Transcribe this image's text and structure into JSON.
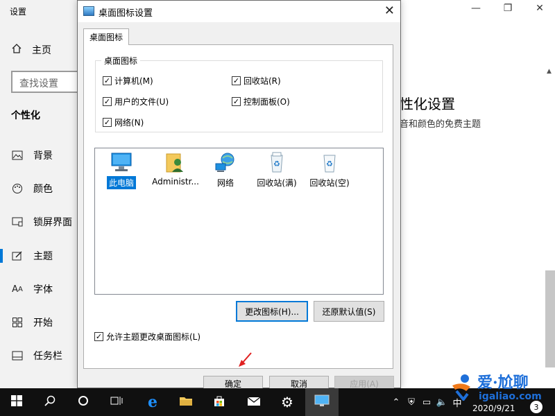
{
  "settings": {
    "window_title": "设置",
    "home_label": "主页",
    "search_placeholder": "查找设置",
    "section_title": "个性化",
    "nav_items": [
      {
        "label": "背景",
        "icon": "picture-icon"
      },
      {
        "label": "颜色",
        "icon": "palette-icon"
      },
      {
        "label": "锁屏界面",
        "icon": "lockscreen-icon"
      },
      {
        "label": "主题",
        "icon": "theme-icon"
      },
      {
        "label": "字体",
        "icon": "font-icon"
      },
      {
        "label": "开始",
        "icon": "start-icon"
      },
      {
        "label": "任务栏",
        "icon": "taskbar-icon"
      }
    ],
    "active_item": "主题",
    "right_heading": "性化设置",
    "right_subtext": "音和颜色的免费主题"
  },
  "dialog": {
    "title": "桌面图标设置",
    "tab_label": "桌面图标",
    "group_label": "桌面图标",
    "checkboxes": [
      {
        "label": "计算机(M)",
        "checked": true
      },
      {
        "label": "回收站(R)",
        "checked": true
      },
      {
        "label": "用户的文件(U)",
        "checked": true
      },
      {
        "label": "控制面板(O)",
        "checked": true
      },
      {
        "label": "网络(N)",
        "checked": true
      }
    ],
    "icons": [
      {
        "label": "此电脑",
        "icon": "computer-icon",
        "selected": true
      },
      {
        "label": "Administr...",
        "icon": "user-folder-icon",
        "selected": false
      },
      {
        "label": "网络",
        "icon": "network-icon",
        "selected": false
      },
      {
        "label": "回收站(满)",
        "icon": "recycle-bin-full-icon",
        "selected": false
      },
      {
        "label": "回收站(空)",
        "icon": "recycle-bin-empty-icon",
        "selected": false
      }
    ],
    "change_icon_btn": "更改图标(H)...",
    "restore_default_btn": "还原默认值(S)",
    "allow_themes_label": "允许主题更改桌面图标(L)",
    "allow_themes_checked": true,
    "ok_btn": "确定",
    "cancel_btn": "取消",
    "apply_btn": "应用(A)"
  },
  "taskbar": {
    "ime": "中",
    "date": "2020/9/21",
    "notification_count": "3"
  },
  "watermark": {
    "line1": "爱·尬聊",
    "line2": "igaliao.com"
  },
  "colors": {
    "accent": "#0078d7",
    "taskbar": "#101010",
    "dialog_bg": "#f0f0f0"
  }
}
